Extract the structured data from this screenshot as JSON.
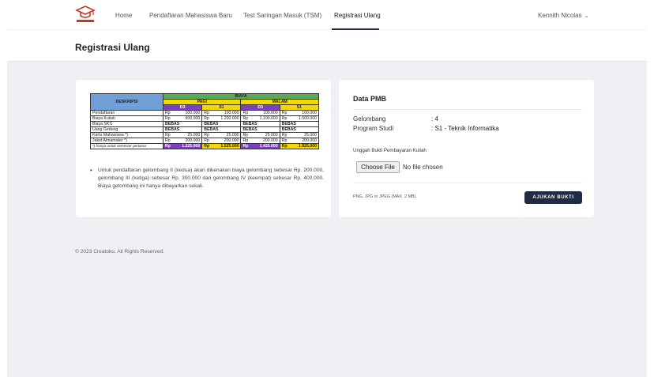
{
  "nav": {
    "items": [
      {
        "label": "Home"
      },
      {
        "label": "Pendaftaran Mahasiswa Baru"
      },
      {
        "label": "Test Saringan Masuk (TSM)"
      },
      {
        "label": "Registrasi Ulang"
      }
    ],
    "active_index": 3,
    "user": "Kennith Nicolas"
  },
  "page": {
    "title": "Registrasi Ulang"
  },
  "fee_table": {
    "header_desc": "DESKRIPSI",
    "header_biaya": "BIAYA",
    "header_pagi": "PAGI",
    "header_malam": "MALAM",
    "levels": [
      "D3",
      "S1",
      "D3",
      "S1"
    ],
    "rows": [
      {
        "label": "Pendaftaran",
        "cells": [
          [
            "Rp",
            "100.000"
          ],
          [
            "Rp",
            "100.000"
          ],
          [
            "Rp",
            "100.000"
          ],
          [
            "Rp",
            "100.000"
          ]
        ]
      },
      {
        "label": "Biaya Kuliah",
        "cells": [
          [
            "Rp",
            "900.000"
          ],
          [
            "Rp",
            "1.200.000"
          ],
          [
            "Rp",
            "1.100.000"
          ],
          [
            "Rp",
            "1.500.000"
          ]
        ]
      },
      {
        "label": "Biaya SKS",
        "cells": [
          [
            "BEBAS",
            ""
          ],
          [
            "BEBAS",
            ""
          ],
          [
            "BEBAS",
            ""
          ],
          [
            "BEBAS",
            ""
          ]
        ]
      },
      {
        "label": "Uang Gedung",
        "cells": [
          [
            "BEBAS",
            ""
          ],
          [
            "BEBAS",
            ""
          ],
          [
            "BEBAS",
            ""
          ],
          [
            "BEBAS",
            ""
          ]
        ]
      },
      {
        "label": "Kartu Mahasiswa *)",
        "cells": [
          [
            "Rp",
            "25.000"
          ],
          [
            "Rp",
            "25.000"
          ],
          [
            "Rp",
            "25.000"
          ],
          [
            "Rp",
            "25.000"
          ]
        ]
      },
      {
        "label": "Jaket Almamater *)",
        "cells": [
          [
            "Rp",
            "200.000"
          ],
          [
            "Rp",
            "200.000"
          ],
          [
            "Rp",
            "200.000"
          ],
          [
            "Rp",
            "200.000"
          ]
        ]
      }
    ],
    "total_note": "*) hanya untuk semester pertama",
    "totals": [
      [
        "Rp",
        "1.225.000"
      ],
      [
        "Rp",
        "1.525.000"
      ],
      [
        "Rp",
        "1.425.000"
      ],
      [
        "Rp",
        "1.825.000"
      ]
    ]
  },
  "fee_note": "Untuk pendaftaran gelombang II (kedua) akan dikenakan biaya gelombang sebesar Rp. 200.000, gelombang III (ketiga) sebesar Rp. 300.000 dan gelombang IV (keempat) sebesar Rp. 400.000. Biaya gelombang ini hanya dibayarkan sekali.",
  "pmb": {
    "title": "Data PMB",
    "gelombang_label": "Gelombang",
    "gelombang_value": ": 4",
    "prodi_label": "Program Studi",
    "prodi_value": ": S1 - Teknik Informatika",
    "upload_label": "Unggah Bukti Pembayaran Kuliah",
    "file_button": "Choose File",
    "file_status": "No file chosen",
    "hint": "PNG, JPG or JPEG (MAX. 2 MB).",
    "submit": "AJUKAN BUKTI"
  },
  "footer": {
    "text": "© 2023 Creatoku. All Rights Reserved."
  },
  "colors": {
    "primary": "#1f2a44",
    "header_blue": "#6f9fd8",
    "header_green": "#5aa85a",
    "header_yellow": "#f5d800",
    "level_purple": "#7b3fbf"
  }
}
